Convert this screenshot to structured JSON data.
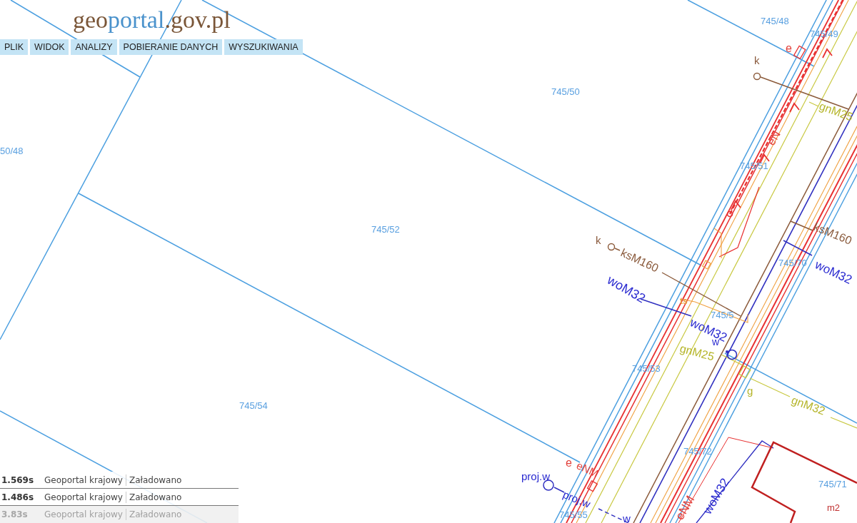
{
  "logo": {
    "parts": [
      {
        "text": "geo",
        "color": "#7a5638"
      },
      {
        "text": "portal",
        "color": "#4a92cc"
      },
      {
        "text": ".gov.pl",
        "color": "#7a5638"
      }
    ]
  },
  "menu": [
    {
      "label": "PLIK"
    },
    {
      "label": "WIDOK"
    },
    {
      "label": "ANALIZY"
    },
    {
      "label": "POBIERANIE DANYCH"
    },
    {
      "label": "WYSZUKIWANIA"
    }
  ],
  "map": {
    "parcel_labels": [
      "745/48",
      "745/49",
      "745/50",
      "50/48",
      "745/51",
      "745/52",
      "745/70",
      "745/5",
      "745/53",
      "745/54",
      "745/72",
      "745/71",
      "745/55"
    ],
    "network_labels": [
      {
        "text": "e",
        "color": "#e2403a"
      },
      {
        "text": "k",
        "color": "#8a5a3c"
      },
      {
        "text": "gnM25",
        "color": "#b5b52a"
      },
      {
        "text": "eN",
        "color": "#e2403a"
      },
      {
        "text": "ksM160",
        "color": "#8a5a3c"
      },
      {
        "text": "k",
        "color": "#8a5a3c"
      },
      {
        "text": "ksM160",
        "color": "#8a5a3c"
      },
      {
        "text": "woM32",
        "color": "#2a2ad0"
      },
      {
        "text": "woM32",
        "color": "#2a2ad0"
      },
      {
        "text": "ts",
        "color": "#e8a040"
      },
      {
        "text": "woM32",
        "color": "#2a2ad0"
      },
      {
        "text": "w",
        "color": "#2a2ad0"
      },
      {
        "text": "gnM25",
        "color": "#b5b52a"
      },
      {
        "text": "g",
        "color": "#b5b52a"
      },
      {
        "text": "gnM32",
        "color": "#b5b52a"
      },
      {
        "text": "e",
        "color": "#e2403a"
      },
      {
        "text": "eNM",
        "color": "#e2403a"
      },
      {
        "text": "proj.w",
        "color": "#2a2ad0"
      },
      {
        "text": "proj.w",
        "color": "#2a2ad0"
      },
      {
        "text": "woM32",
        "color": "#2a2ad0"
      },
      {
        "text": "eNM",
        "color": "#e2403a"
      },
      {
        "text": "m2",
        "color": "#c03030"
      },
      {
        "text": "w",
        "color": "#2a2ad0"
      }
    ]
  },
  "load_log": [
    {
      "time": "1.569s",
      "layer": "Geoportal krajowy",
      "status": "Załadowano",
      "faded": false
    },
    {
      "time": "1.486s",
      "layer": "Geoportal krajowy",
      "status": "Załadowano",
      "faded": false
    },
    {
      "time": "3.83s",
      "layer": "Geoportal krajowy",
      "status": "Załadowano",
      "faded": true
    }
  ]
}
